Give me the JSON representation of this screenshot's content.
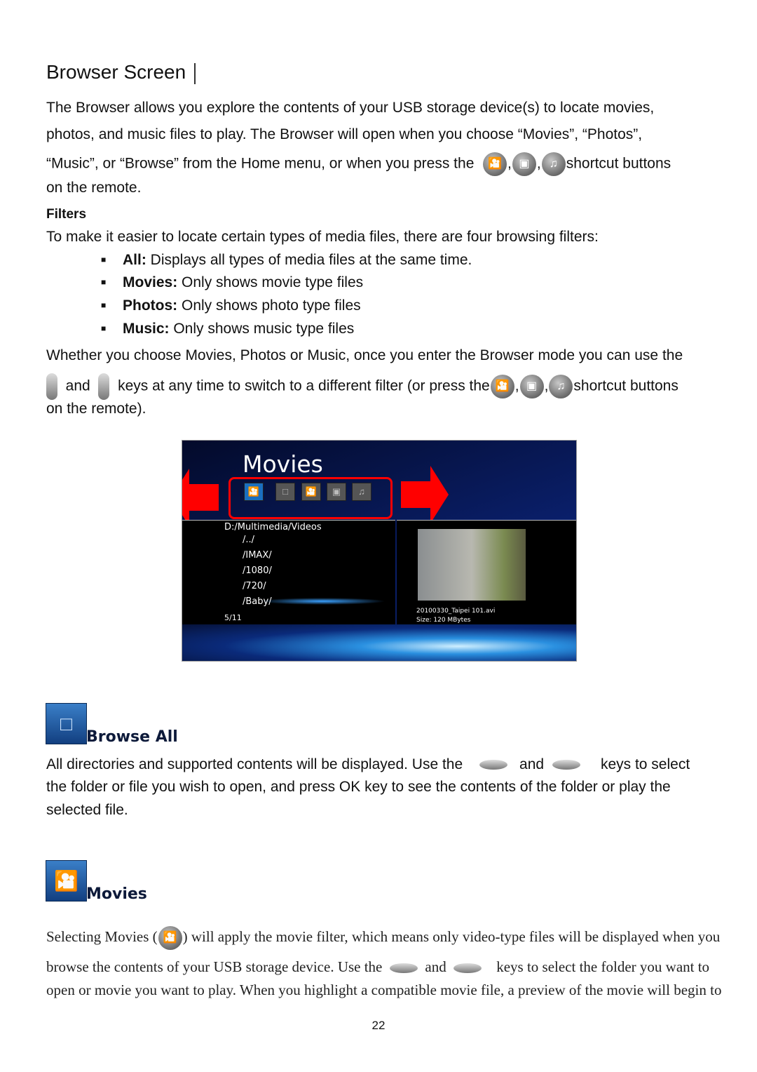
{
  "title": "Browser Screen",
  "intro": {
    "l1": "The Browser allows you explore the contents of your USB storage device(s) to locate movies,",
    "l2": "photos, and music files to play. The Browser will open when you choose “Movies”, “Photos”,",
    "l3": "“Music”, or “Browse” from the Home menu, or when you press the",
    "l3b": "shortcut buttons",
    "l4": "on the remote."
  },
  "filters": {
    "heading": "Filters",
    "lead": "To make it easier to locate certain types of media files, there are four browsing filters:",
    "items": [
      {
        "term": "All:",
        "desc": " Displays all types of media files at the same time."
      },
      {
        "term": "Movies:",
        "desc": " Only shows movie type files"
      },
      {
        "term": "Photos:",
        "desc": " Only shows photo type files"
      },
      {
        "term": "Music:",
        "desc": " Only shows music type files"
      }
    ]
  },
  "switch": {
    "l1": "Whether you choose Movies, Photos or Music, once you enter the Browser mode you can use the",
    "and": "and",
    "l2": "keys at any time to switch to a different filter (or press the",
    "l2b": "shortcut buttons",
    "l3": "on the remote)."
  },
  "screenshot": {
    "title": "Movies",
    "path": "D:/Multimedia/Videos",
    "folders": [
      "/../",
      "/IMAX/",
      "/1080/",
      "/720/",
      "/Baby/"
    ],
    "counter": "5/11",
    "file": "20100330_Taipei 101.avi",
    "size": "Size: 120 MBytes"
  },
  "browse_all": {
    "label": "Browse All",
    "l1a": "All directories and supported contents will be displayed. Use the",
    "and": "and",
    "l1b": "keys to select",
    "l2": "the folder or file you wish to open, and press OK key to see the contents of the folder or play the",
    "l3": "selected file."
  },
  "movies": {
    "label": "Movies",
    "l1a": "Selecting Movies (",
    "l1b": ") will apply the movie filter, which means only video-type files will be displayed when you",
    "l2a": "browse the contents of your USB storage device. Use the",
    "and": "and",
    "l2b": "keys to select the folder you want to",
    "l3": "open or movie you want to play. When you highlight a compatible movie file, a preview of the movie will begin to"
  },
  "page_number": "22"
}
